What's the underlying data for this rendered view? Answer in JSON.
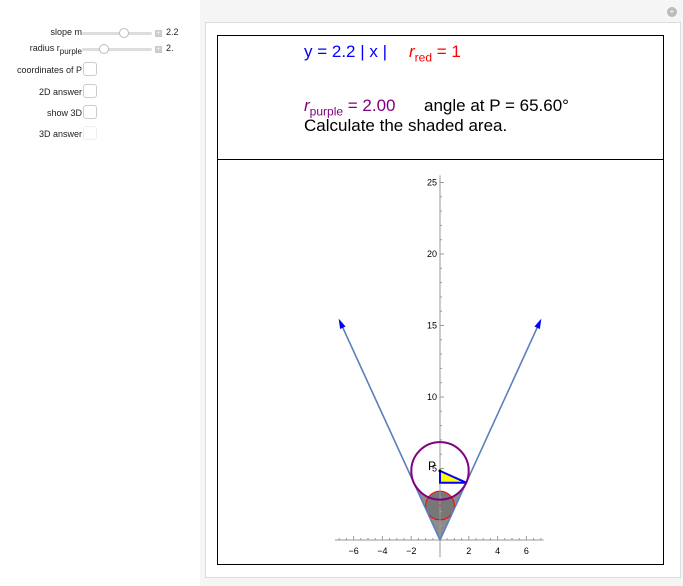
{
  "controls": {
    "slope": {
      "label": "slope m",
      "value": "2.2",
      "fraction": 0.62
    },
    "radius": {
      "label": "radius r",
      "label_sub": "purple",
      "value": "2.",
      "fraction": 0.28
    },
    "checkboxes": [
      {
        "label": "coordinates of P",
        "checked": false
      },
      {
        "label": "2D answer",
        "checked": false
      },
      {
        "label": "show 3D",
        "checked": false
      },
      {
        "label": "3D answer",
        "checked": false,
        "disabled": true
      }
    ]
  },
  "header": {
    "equation": "y = 2.2 | x |",
    "rred_sym": "r",
    "rred_sub": "red",
    "rred_val": "= 1",
    "rpurple_sym": "r",
    "rpurple_sub": "purple",
    "rpurple_val": "= 2.00",
    "angle": "angle at P = 65.60°",
    "instruction": "Calculate the shaded area."
  },
  "colors": {
    "blue": "#0000ff",
    "red": "#ff0000",
    "purple": "#800080",
    "line": "#5b7fb9",
    "shade": "#8c8c8c",
    "triangle": "#ffff00"
  },
  "chart_data": {
    "type": "line",
    "slope": 2.2,
    "r_red": 1,
    "r_purple": 2.0,
    "point_label": "P",
    "x_ticks": [
      -6,
      -4,
      -2,
      2,
      4,
      6
    ],
    "y_ticks": [
      5,
      10,
      15,
      20,
      25
    ],
    "xlim": [
      -7.3,
      7.2
    ],
    "ylim": [
      -1.2,
      25.5
    ]
  }
}
